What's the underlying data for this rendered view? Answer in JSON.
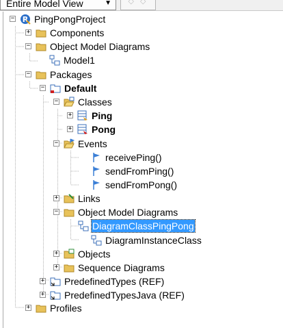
{
  "toolbar": {
    "view_select_value": "Entire Model View",
    "nav_glyphs": "◇ ◇"
  },
  "tree": {
    "project": "PingPongProject",
    "components": "Components",
    "omd": "Object Model Diagrams",
    "model1": "Model1",
    "packages": "Packages",
    "default": "Default",
    "classes": "Classes",
    "ping": "Ping",
    "pong": "Pong",
    "events": "Events",
    "receive_ping": "receivePing()",
    "send_from_ping": "sendFromPing()",
    "send_from_pong": "sendFromPong()",
    "links": "Links",
    "omd2": "Object Model Diagrams",
    "diagram_class": "DiagramClassPingPong",
    "diagram_instance": "DiagramInstanceClass",
    "objects": "Objects",
    "sequence_diagrams": "Sequence Diagrams",
    "predefined_types": "PredefinedTypes (REF)",
    "predefined_types_java": "PredefinedTypesJava (REF)",
    "profiles": "Profiles"
  },
  "colors": {
    "folder": "#e8c25a",
    "selection": "#3399ff",
    "flag": "#3b7fd6",
    "guide": "#b0b0b0"
  },
  "icons": {
    "project": "rhapsody-project-icon",
    "folder": "folder-icon",
    "diagram": "diagram-icon",
    "package": "package-icon",
    "class": "class-icon",
    "event": "event-flag-icon"
  }
}
